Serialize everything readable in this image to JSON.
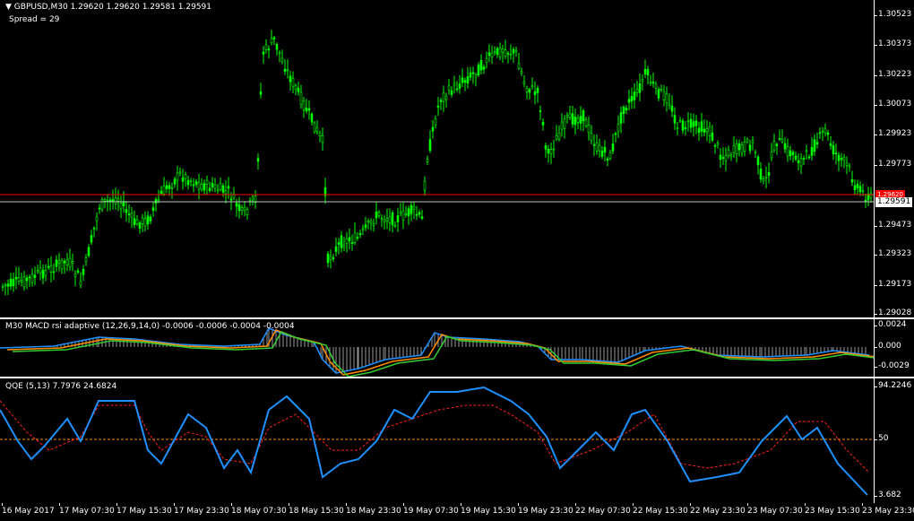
{
  "main_chart": {
    "symbol_label": "GBPUSD,M30",
    "ohlc": "1.29620 1.29620 1.29581 1.29591",
    "spread": "Spread = 29",
    "price_levels": [
      "1.30523",
      "1.30373",
      "1.30223",
      "1.30073",
      "1.29923",
      "1.29773",
      "1.29591",
      "1.29473",
      "1.29323",
      "1.29173",
      "1.29028"
    ],
    "current_price": "1.29591",
    "bid_line_price": "1.29620",
    "candle_color": "#00ff00",
    "bid_line_color": "#ff0000",
    "ask_line_color": "#c0c0c0"
  },
  "macd_pane": {
    "title": "M30 MACD rsi adaptive (12,26,9,14,0)",
    "values": "-0.0006 -0.0006 -0.0004 -0.0004",
    "levels": [
      "0.0024",
      "0.000",
      "-0.0029"
    ],
    "colors": {
      "histogram": "#ffffff",
      "fast": "#1e90ff",
      "orange": "#ff8c00",
      "green": "#32cd32"
    }
  },
  "qqe_pane": {
    "title": "QQE (5,13)",
    "values": "7.7976 24.6824",
    "levels": [
      "94.2246",
      "50",
      "3.682"
    ],
    "colors": {
      "rsi": "#1e90ff",
      "trail": "#ff2020",
      "mid": "#ff8c00"
    }
  },
  "time_axis": [
    "16 May 2017",
    "17 May 07:30",
    "17 May 15:30",
    "17 May 23:30",
    "18 May 07:30",
    "18 May 15:30",
    "18 May 23:30",
    "19 May 07:30",
    "19 May 15:30",
    "19 May 23:30",
    "22 May 07:30",
    "22 May 15:30",
    "22 May 23:30",
    "23 May 07:30",
    "23 May 15:30",
    "23 May 23:30"
  ]
}
